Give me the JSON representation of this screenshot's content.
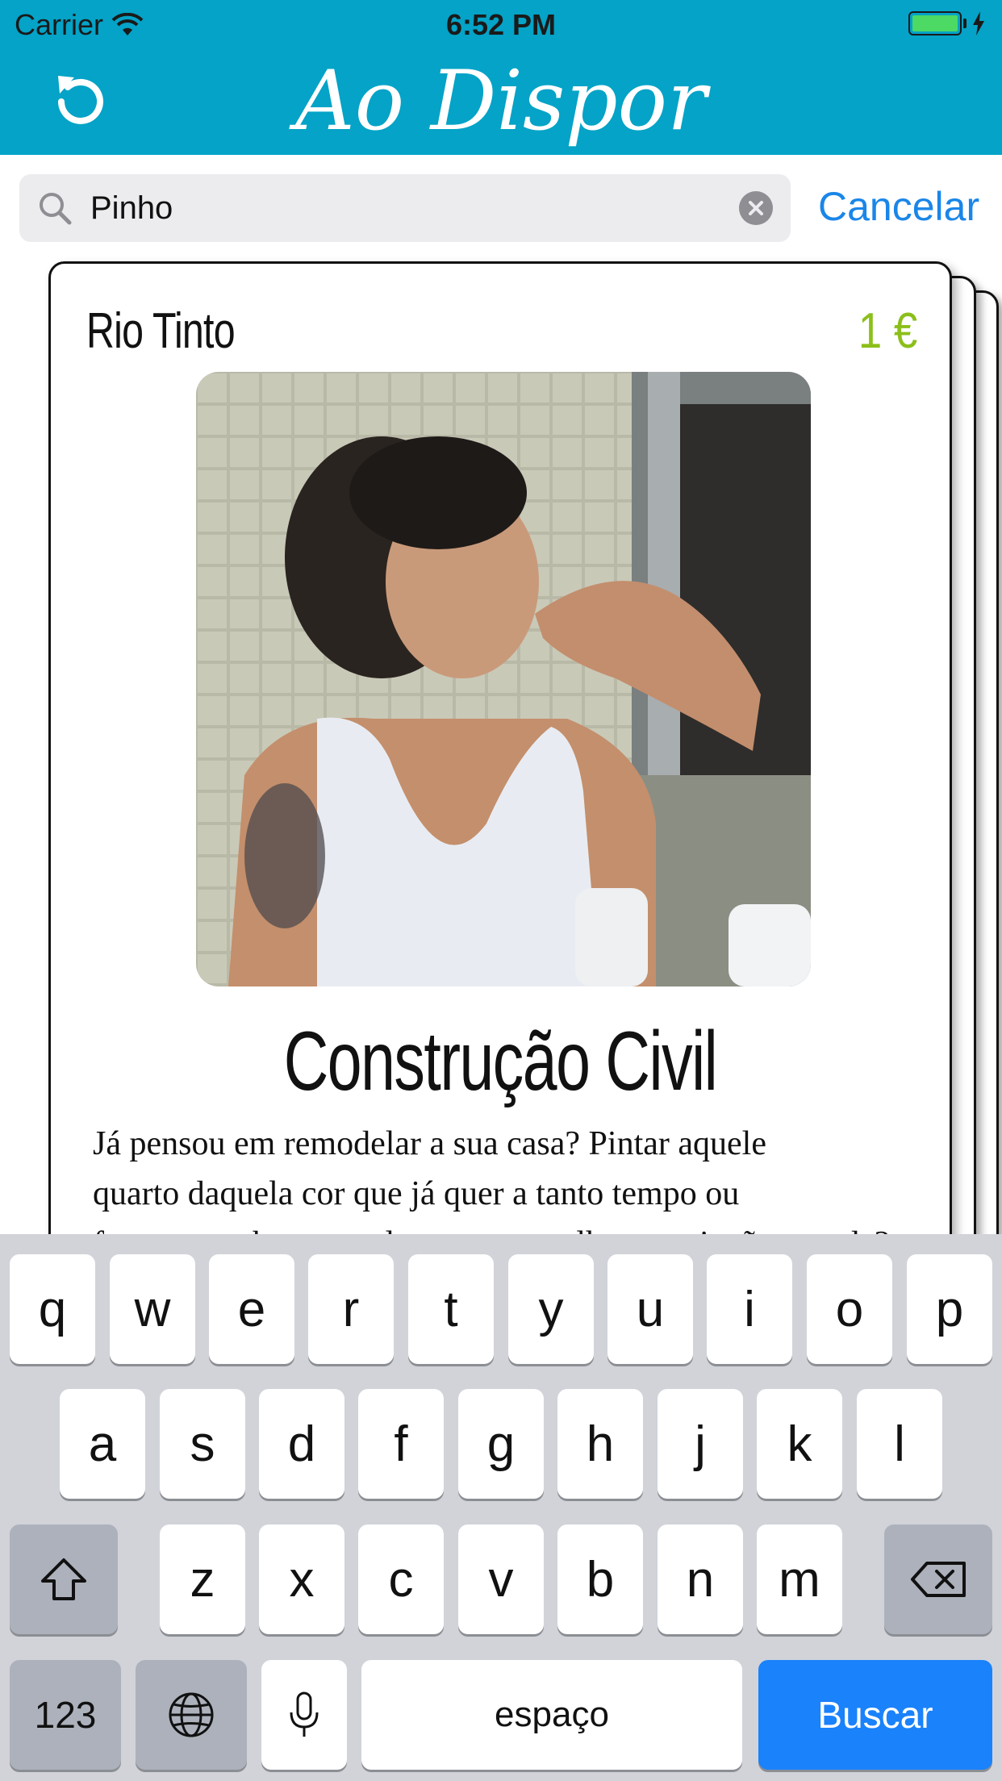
{
  "status": {
    "carrier": "Carrier",
    "time": "6:52 PM"
  },
  "header": {
    "title": "Ao Dispor",
    "refresh_icon": "refresh-icon"
  },
  "search": {
    "value": "Pinho",
    "cancel_label": "Cancelar"
  },
  "card": {
    "location": "Rio Tinto",
    "price": "1 €",
    "category": "Construção Civil",
    "description_line1": "Já pensou em remodelar a sua casa? Pintar aquele",
    "description_line2": "quarto daquela cor que já quer a tanto tempo ou",
    "description_line3": "fazer uma obra naquele espaço que lhe parecia tão grande?",
    "photo_icon": "profile-photo"
  },
  "keyboard": {
    "row1": [
      "q",
      "w",
      "e",
      "r",
      "t",
      "y",
      "u",
      "i",
      "o",
      "p"
    ],
    "row2": [
      "a",
      "s",
      "d",
      "f",
      "g",
      "h",
      "j",
      "k",
      "l"
    ],
    "row3": [
      "z",
      "x",
      "c",
      "v",
      "b",
      "n",
      "m"
    ],
    "numbers_label": "123",
    "space_label": "espaço",
    "search_label": "Buscar"
  },
  "colors": {
    "header": "#04a3c7",
    "accent": "#1a86e8",
    "price": "#8cbf1a",
    "search_key": "#1a82fb"
  }
}
